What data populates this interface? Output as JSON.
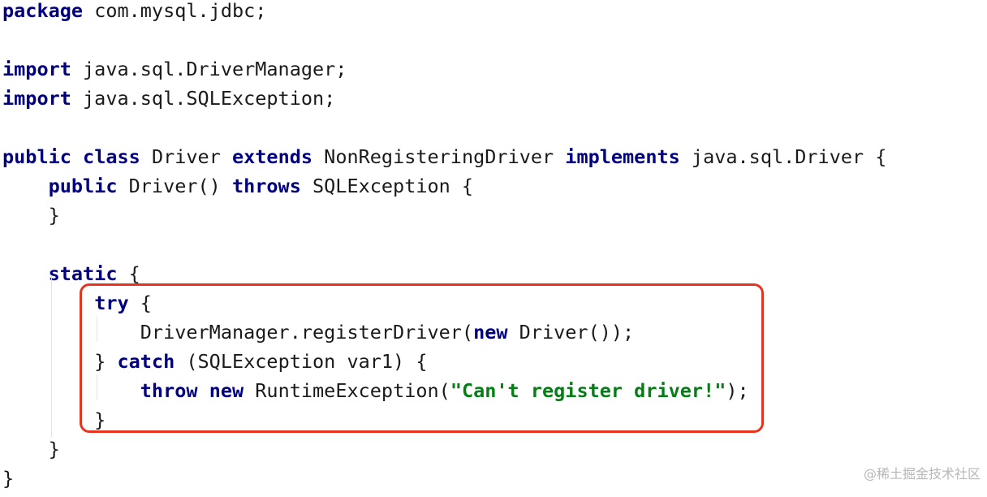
{
  "code": {
    "lines": [
      [
        {
          "t": "package",
          "k": "kw"
        },
        {
          "t": " com.mysql.jdbc;",
          "k": "plain"
        }
      ],
      [],
      [
        {
          "t": "import",
          "k": "kw"
        },
        {
          "t": " java.sql.DriverManager;",
          "k": "plain"
        }
      ],
      [
        {
          "t": "import",
          "k": "kw"
        },
        {
          "t": " java.sql.SQLException;",
          "k": "plain"
        }
      ],
      [],
      [
        {
          "t": "public",
          "k": "kw"
        },
        {
          "t": " ",
          "k": "plain"
        },
        {
          "t": "class",
          "k": "kw"
        },
        {
          "t": " Driver ",
          "k": "plain"
        },
        {
          "t": "extends",
          "k": "kw"
        },
        {
          "t": " NonRegisteringDriver ",
          "k": "plain"
        },
        {
          "t": "implements",
          "k": "kw"
        },
        {
          "t": " java.sql.Driver {",
          "k": "plain"
        }
      ],
      [
        {
          "t": "    ",
          "k": "plain"
        },
        {
          "t": "public",
          "k": "kw"
        },
        {
          "t": " Driver() ",
          "k": "plain"
        },
        {
          "t": "throws",
          "k": "kw"
        },
        {
          "t": " SQLException {",
          "k": "plain"
        }
      ],
      [
        {
          "t": "    }",
          "k": "plain"
        }
      ],
      [],
      [
        {
          "t": "    ",
          "k": "plain"
        },
        {
          "t": "static",
          "k": "kw"
        },
        {
          "t": " {",
          "k": "plain"
        }
      ],
      [
        {
          "t": "        ",
          "k": "plain"
        },
        {
          "t": "try",
          "k": "kw"
        },
        {
          "t": " {",
          "k": "plain"
        }
      ],
      [
        {
          "t": "            DriverManager.registerDriver(",
          "k": "plain"
        },
        {
          "t": "new",
          "k": "kw"
        },
        {
          "t": " Driver());",
          "k": "plain"
        }
      ],
      [
        {
          "t": "        } ",
          "k": "plain"
        },
        {
          "t": "catch",
          "k": "kw"
        },
        {
          "t": " (SQLException var1) {",
          "k": "plain"
        }
      ],
      [
        {
          "t": "            ",
          "k": "plain"
        },
        {
          "t": "throw",
          "k": "kw"
        },
        {
          "t": " ",
          "k": "plain"
        },
        {
          "t": "new",
          "k": "kw"
        },
        {
          "t": " RuntimeException(",
          "k": "plain"
        },
        {
          "t": "\"Can't register driver!\"",
          "k": "str"
        },
        {
          "t": ");",
          "k": "plain"
        }
      ],
      [
        {
          "t": "        }",
          "k": "plain"
        }
      ],
      [
        {
          "t": "    }",
          "k": "plain"
        }
      ],
      [
        {
          "t": "}",
          "k": "plain"
        }
      ]
    ]
  },
  "highlight": {
    "color": "#e8341f"
  },
  "watermark": {
    "text": "@稀土掘金技术社区"
  }
}
